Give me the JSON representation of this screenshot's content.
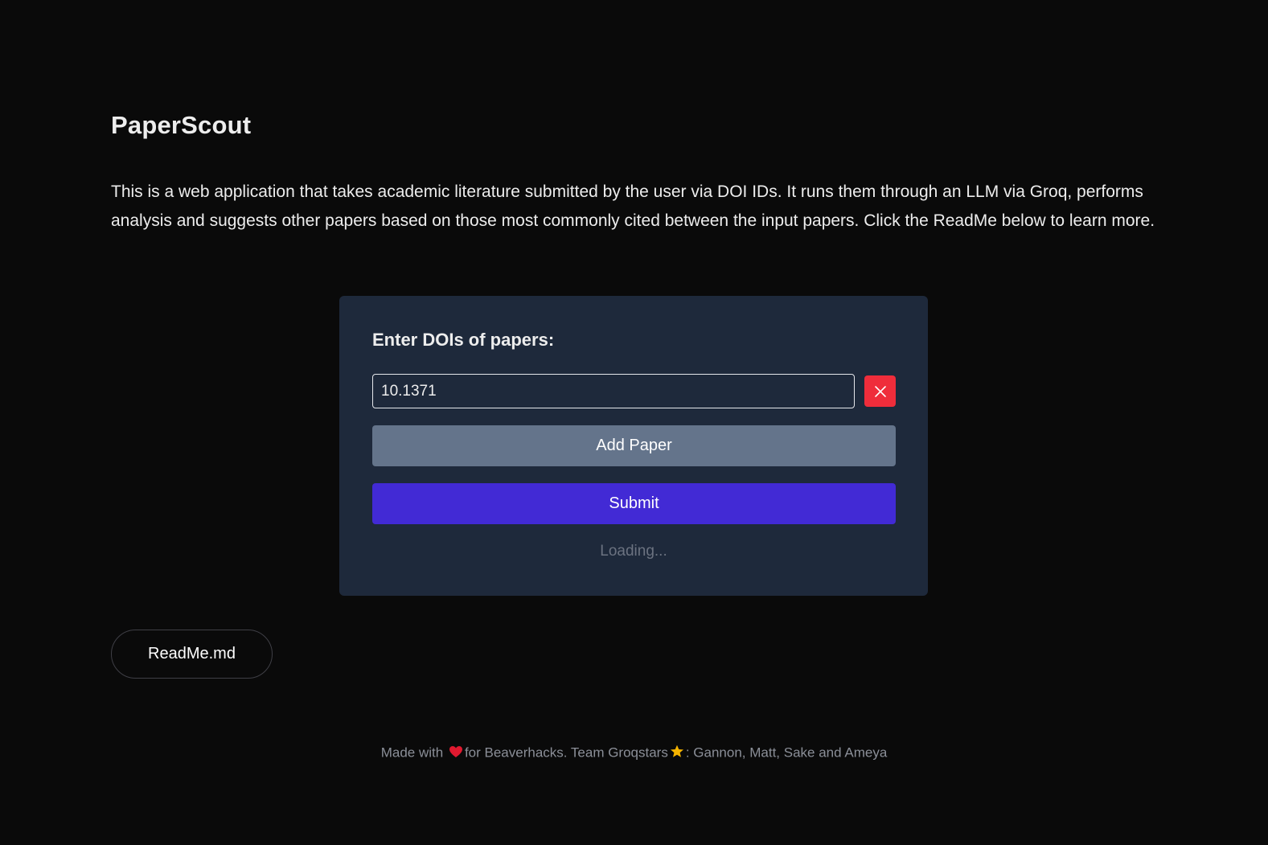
{
  "app": {
    "title": "PaperScout",
    "description": "This is a web application that takes academic literature submitted by the user via DOI IDs. It runs them through an LLM via Groq, performs analysis and suggests other papers based on those most commonly cited between the input papers. Click the ReadMe below to learn more."
  },
  "form": {
    "label": "Enter DOIs of papers:",
    "doi_value": "10.1371",
    "remove_icon": "close-icon",
    "add_label": "Add Paper",
    "submit_label": "Submit",
    "loading_text": "Loading..."
  },
  "readme": {
    "label": "ReadMe.md"
  },
  "footer": {
    "part1": "Made with",
    "heart_icon": "heart-icon",
    "part2": "for Beaverhacks. Team Groqstars",
    "star_icon": "star-icon",
    "part3": ": Gannon, Matt, Sake and Ameya"
  },
  "colors": {
    "background": "#0a0a0a",
    "card": "#1e293b",
    "add_button": "#64748b",
    "submit_button": "#422ad5",
    "remove_button": "#ef2d3b",
    "heart": "#e0192f",
    "star": "#f5b400"
  }
}
